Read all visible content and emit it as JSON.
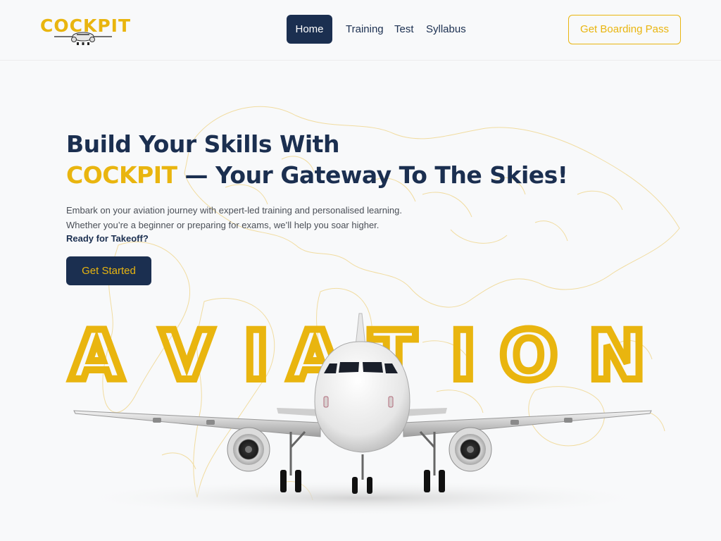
{
  "header": {
    "logo": "COCKPIT",
    "nav": [
      "Home",
      "Training",
      "Test",
      "Syllabus"
    ],
    "active_index": 0,
    "boarding_button": "Get Boarding Pass"
  },
  "hero": {
    "title_line1": "Build Your Skills With",
    "title_accent": "COCKPIT",
    "title_rest": " — Your Gateway To The Skies!",
    "description": "Embark on your aviation journey with expert-led training and personalised learning. Whether you’re a beginner or preparing for exams, we’ll help you soar higher.",
    "cta_text": "Ready for Takeoff?",
    "start_button": "Get Started"
  },
  "banner": {
    "letters": [
      "A",
      "V",
      "I",
      "A",
      "T",
      "I",
      "O",
      "N"
    ]
  },
  "colors": {
    "accent": "#e9b50f",
    "navy": "#1b2f50",
    "background": "#f8f9fa"
  },
  "icons": {
    "logo_mark": "airplane-icon",
    "hero_image": "airplane-front-view"
  }
}
